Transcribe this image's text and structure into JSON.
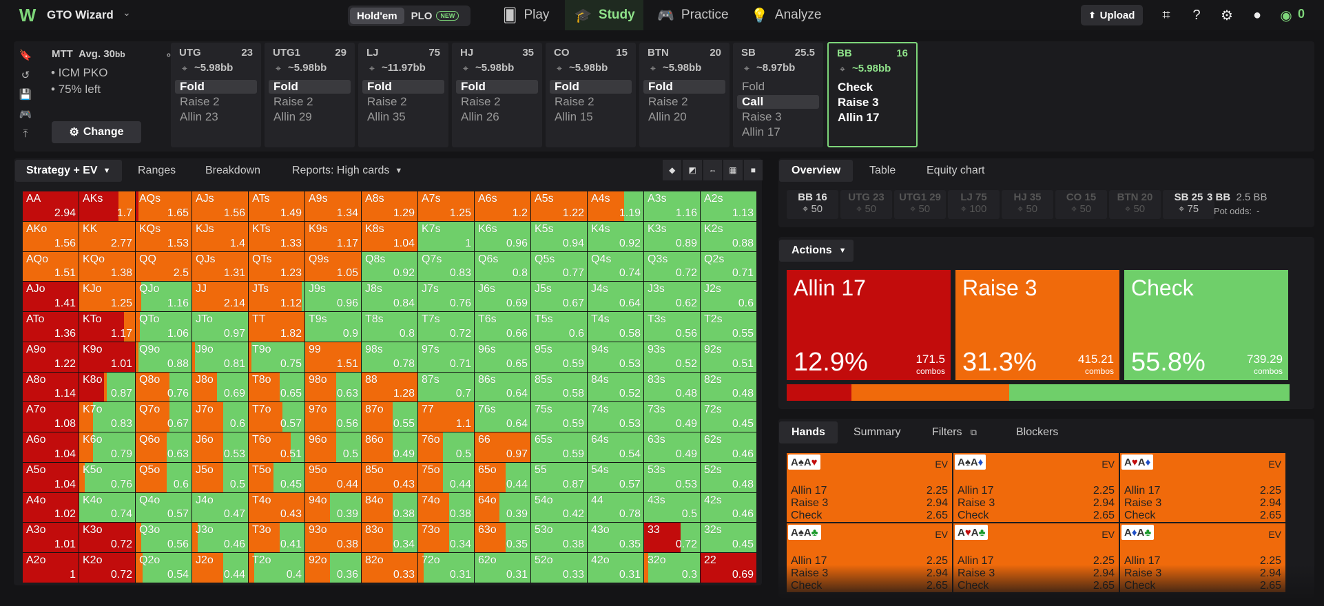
{
  "brand": {
    "name": "GTO Wizard"
  },
  "game_toggle": {
    "holdem": "Hold'em",
    "plo": "PLO",
    "new_badge": "NEW"
  },
  "nav": {
    "play": "Play",
    "study": "Study",
    "practice": "Practice",
    "analyze": "Analyze"
  },
  "topbar": {
    "upload": "Upload",
    "coins": "0"
  },
  "spot": {
    "title": "MTT",
    "avg_label": "Avg. 30",
    "avg_unit": "bb",
    "bullets": [
      "• ICM PKO",
      "• 75% left"
    ],
    "change": "Change",
    "positions": [
      {
        "name": "UTG",
        "stack": "23",
        "bb": "~5.98bb",
        "actions": [
          "Fold",
          "Raise 2",
          "Allin 23"
        ],
        "selected": 0
      },
      {
        "name": "UTG1",
        "stack": "29",
        "bb": "~5.98bb",
        "actions": [
          "Fold",
          "Raise 2",
          "Allin 29"
        ],
        "selected": 0
      },
      {
        "name": "LJ",
        "stack": "75",
        "bb": "~11.97bb",
        "actions": [
          "Fold",
          "Raise 2",
          "Allin 35"
        ],
        "selected": 0
      },
      {
        "name": "HJ",
        "stack": "35",
        "bb": "~5.98bb",
        "actions": [
          "Fold",
          "Raise 2",
          "Allin 26"
        ],
        "selected": 0
      },
      {
        "name": "CO",
        "stack": "15",
        "bb": "~5.98bb",
        "actions": [
          "Fold",
          "Raise 2",
          "Allin 15"
        ],
        "selected": 0
      },
      {
        "name": "BTN",
        "stack": "20",
        "bb": "~5.98bb",
        "actions": [
          "Fold",
          "Raise 2",
          "Allin 20"
        ],
        "selected": 0
      },
      {
        "name": "SB",
        "stack": "25.5",
        "bb": "~8.97bb",
        "actions": [
          "Fold",
          "Call",
          "Raise 3",
          "Allin 17"
        ],
        "selected": 1
      },
      {
        "name": "BB",
        "stack": "16",
        "bb": "~5.98bb",
        "actions": [
          "Check",
          "Raise 3",
          "Allin 17"
        ],
        "selected": -1,
        "active": true
      }
    ]
  },
  "left_tabs": {
    "strategy": "Strategy + EV",
    "ranges": "Ranges",
    "breakdown": "Breakdown",
    "reports": "Reports: High cards"
  },
  "matrix": [
    [
      "AA 2.94 r100",
      "AKs 1.7 r70 o30",
      "AQs 1.65 r5 o95",
      "AJs 1.56 o100",
      "ATs 1.49 o100",
      "A9s 1.34 o100",
      "A8s 1.29 o100",
      "A7s 1.25 o100",
      "A6s 1.2 o100",
      "A5s 1.22 o100",
      "A4s 1.19 o65",
      "A3s 1.16 g",
      "A2s 1.13 g"
    ],
    [
      "AKo 1.56 o100",
      "KK 2.77 o100",
      "KQs 1.53 o100",
      "KJs 1.4 o100",
      "KTs 1.33 o100",
      "K9s 1.17 o100",
      "K8s 1.04 o100",
      "K7s 1 g",
      "K6s 0.96 g",
      "K5s 0.94 g",
      "K4s 0.92 g",
      "K3s 0.89 g",
      "K2s 0.88 g"
    ],
    [
      "AQo 1.51 o100",
      "KQo 1.38 o100",
      "QQ 2.5 o100",
      "QJs 1.31 o100",
      "QTs 1.23 o100",
      "Q9s 1.05 o100",
      "Q8s 0.92 g",
      "Q7s 0.83 g",
      "Q6s 0.8 g",
      "Q5s 0.77 g",
      "Q4s 0.74 g",
      "Q3s 0.72 g",
      "Q2s 0.71 g"
    ],
    [
      "AJo 1.41 r100",
      "KJo 1.25 o100",
      "QJo 1.16 o10",
      "JJ 2.14 o100",
      "JTs 1.12 o95",
      "J9s 0.96 g",
      "J8s 0.84 g",
      "J7s 0.76 g",
      "J6s 0.69 g",
      "J5s 0.67 g",
      "J4s 0.64 g",
      "J3s 0.62 g",
      "J2s 0.6 g"
    ],
    [
      "ATo 1.36 r100",
      "KTo 1.17 r80 o20",
      "QTo 1.06 o8",
      "JTo 0.97 g",
      "TT 1.82 o100",
      "T9s 0.9 g",
      "T8s 0.8 g",
      "T7s 0.72 g",
      "T6s 0.66 g",
      "T5s 0.6 g",
      "T4s 0.58 g",
      "T3s 0.56 g",
      "T2s 0.55 g"
    ],
    [
      "A9o 1.22 r100",
      "K9o 1.01 r100",
      "Q9o 0.88 o5",
      "J9o 0.81 o5",
      "T9o 0.75 o5",
      "99 1.51 o100",
      "98s 0.78 g",
      "97s 0.71 g",
      "96s 0.65 g",
      "95s 0.59 g",
      "94s 0.53 g",
      "93s 0.52 g",
      "92s 0.51 g"
    ],
    [
      "A8o 1.14 r100",
      "K8o 0.87 r45 o5",
      "Q8o 0.76 o60",
      "J8o 0.69 o45",
      "T8o 0.65 o55",
      "98o 0.63 o55",
      "88 1.28 o100",
      "87s 0.7 g",
      "86s 0.64 g",
      "85s 0.58 g",
      "84s 0.52 g",
      "83s 0.48 g",
      "82s 0.48 g"
    ],
    [
      "A7o 1.08 r100",
      "K7o 0.83 o25",
      "Q7o 0.67 o60",
      "J7o 0.6 o55",
      "T7o 0.57 o60",
      "97o 0.56 o55",
      "87o 0.55 o55",
      "77 1.1 o100",
      "76s 0.64 g",
      "75s 0.59 g",
      "74s 0.53 g",
      "73s 0.49 g",
      "72s 0.45 g"
    ],
    [
      "A6o 1.04 r100",
      "K6o 0.79 o25",
      "Q6o 0.63 o55",
      "J6o 0.53 o55",
      "T6o 0.51 o75",
      "96o 0.5 o55",
      "86o 0.49 o55",
      "76o 0.5 o45",
      "66 0.97 o100",
      "65s 0.59 g",
      "64s 0.54 g",
      "63s 0.49 g",
      "62s 0.46 g"
    ],
    [
      "A5o 1.04 r100",
      "K5o 0.76 o10",
      "Q5o 0.6 o55",
      "J5o 0.5 o55",
      "T5o 0.45 o45",
      "95o 0.44 o100",
      "85o 0.43 o100",
      "75o 0.44 o45",
      "65o 0.44 o55",
      "55 0.87 g",
      "54s 0.57 g",
      "53s 0.53 g",
      "52s 0.48 g"
    ],
    [
      "A4o 1.02 r100",
      "K4o 0.74 g",
      "Q4o 0.57 g",
      "J4o 0.47 g",
      "T4o 0.43 o100",
      "94o 0.39 o45",
      "84o 0.38 o55",
      "74o 0.38 o55",
      "64o 0.39 o45",
      "54o 0.42 g",
      "44 0.78 g",
      "43s 0.5 g",
      "42s 0.46 g"
    ],
    [
      "A3o 1.01 r100",
      "K3o 0.72 r100",
      "Q3o 0.56 o10",
      "J3o 0.46 o10",
      "T3o 0.41 o55",
      "93o 0.38 o100",
      "83o 0.34 o55",
      "73o 0.34 o55",
      "63o 0.35 o55",
      "53o 0.38 g",
      "43o 0.35 g",
      "33 0.72 r65",
      "32s 0.45 g"
    ],
    [
      "A2o 1 r100",
      "K2o 0.72 r100",
      "Q2o 0.54 o12",
      "J2o 0.44 o55",
      "T2o 0.4 o10",
      "92o 0.36 o45",
      "82o 0.33 o100",
      "72o 0.31 o10",
      "62o 0.31 g",
      "52o 0.33 g",
      "42o 0.31 g",
      "32o 0.3 o8",
      "22 0.69 r100"
    ]
  ],
  "right_tabs": {
    "overview": "Overview",
    "table": "Table",
    "equity": "Equity chart"
  },
  "stacks": [
    {
      "n": "BB 16",
      "v": "50",
      "on": true
    },
    {
      "n": "UTG 23",
      "v": "50",
      "on": false
    },
    {
      "n": "UTG1 29",
      "v": "50",
      "on": false
    },
    {
      "n": "LJ 75",
      "v": "100",
      "on": false
    },
    {
      "n": "HJ 35",
      "v": "50",
      "on": false
    },
    {
      "n": "CO 15",
      "v": "50",
      "on": false
    },
    {
      "n": "BTN 20",
      "v": "50",
      "on": false
    },
    {
      "n": "SB 25",
      "v": "75",
      "on": true
    }
  ],
  "pot": {
    "main": "3 BB",
    "sub": "2.5 BB",
    "odds_label": "Pot odds:",
    "odds_value": "-"
  },
  "actions_dropdown": "Actions",
  "action_boxes": [
    {
      "title": "Allin 17",
      "pct": "12.9%",
      "combos": "171.5",
      "combos_label": "combos",
      "color": "#c20c0c"
    },
    {
      "title": "Raise 3",
      "pct": "31.3%",
      "combos": "415.21",
      "combos_label": "combos",
      "color": "#f06a0b"
    },
    {
      "title": "Check",
      "pct": "55.8%",
      "combos": "739.29",
      "combos_label": "combos",
      "color": "#6fcf6a"
    }
  ],
  "freq": [
    12.9,
    31.3,
    55.8
  ],
  "hand_tabs": {
    "hands": "Hands",
    "summary": "Summary",
    "filters": "Filters",
    "blockers": "Blockers"
  },
  "hand_cards": [
    {
      "c1": "A",
      "s1": "♠",
      "s1c": "#333",
      "c2": "A",
      "s2": "♥",
      "s2c": "#c20c0c"
    },
    {
      "c1": "A",
      "s1": "♠",
      "s1c": "#333",
      "c2": "A",
      "s2": "♦",
      "s2c": "#1f4fc6"
    },
    {
      "c1": "A",
      "s1": "♥",
      "s1c": "#c20c0c",
      "c2": "A",
      "s2": "♦",
      "s2c": "#1f4fc6"
    },
    {
      "c1": "A",
      "s1": "♠",
      "s1c": "#333",
      "c2": "A",
      "s2": "♣",
      "s2c": "#1a9a2a"
    },
    {
      "c1": "A",
      "s1": "♥",
      "s1c": "#c20c0c",
      "c2": "A",
      "s2": "♣",
      "s2c": "#1a9a2a"
    },
    {
      "c1": "A",
      "s1": "♦",
      "s1c": "#1f4fc6",
      "c2": "A",
      "s2": "♣",
      "s2c": "#1a9a2a"
    }
  ],
  "hand_card_rows": [
    {
      "k": "Allin 17",
      "v": "2.25"
    },
    {
      "k": "Raise 3",
      "v": "2.94"
    },
    {
      "k": "Check",
      "v": "2.65"
    }
  ],
  "ev_label": "EV",
  "colors": {
    "allin": "#c20c0c",
    "raise": "#f06a0b",
    "check": "#6fcf6a",
    "accent": "#7ed67a"
  }
}
